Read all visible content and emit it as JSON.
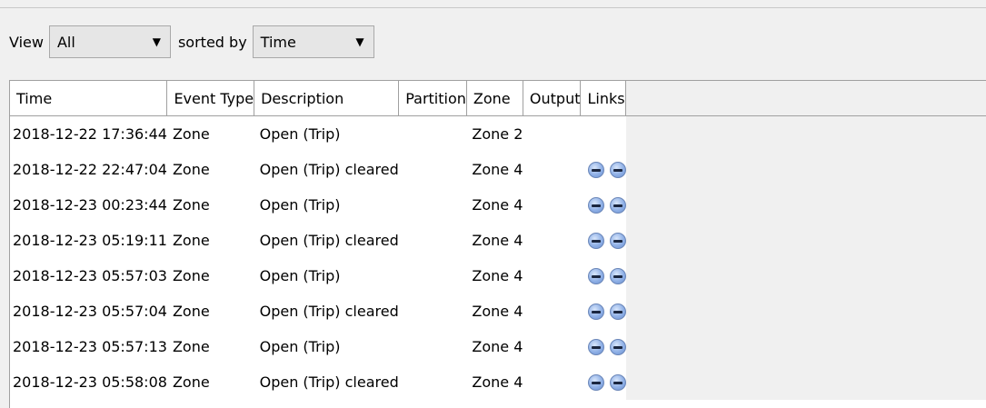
{
  "toolbar": {
    "view_label": "View",
    "view_value": "All",
    "sorted_label": "sorted by",
    "sort_value": "Time"
  },
  "table": {
    "columns": [
      "Time",
      "Event Type",
      "Description",
      "Partition",
      "Zone",
      "Output",
      "Links"
    ],
    "rows": [
      {
        "time": "2018-12-22 17:36:44",
        "event_type": "Zone",
        "description": "Open (Trip)",
        "partition": "",
        "zone": "Zone 2",
        "output": "",
        "links": 0
      },
      {
        "time": "2018-12-22 22:47:04",
        "event_type": "Zone",
        "description": "Open (Trip) cleared",
        "partition": "",
        "zone": "Zone 4",
        "output": "",
        "links": 2
      },
      {
        "time": "2018-12-23 00:23:44",
        "event_type": "Zone",
        "description": "Open (Trip)",
        "partition": "",
        "zone": "Zone 4",
        "output": "",
        "links": 2
      },
      {
        "time": "2018-12-23 05:19:11",
        "event_type": "Zone",
        "description": "Open (Trip) cleared",
        "partition": "",
        "zone": "Zone 4",
        "output": "",
        "links": 2
      },
      {
        "time": "2018-12-23 05:57:03",
        "event_type": "Zone",
        "description": "Open (Trip)",
        "partition": "",
        "zone": "Zone 4",
        "output": "",
        "links": 2
      },
      {
        "time": "2018-12-23 05:57:04",
        "event_type": "Zone",
        "description": "Open (Trip) cleared",
        "partition": "",
        "zone": "Zone 4",
        "output": "",
        "links": 2
      },
      {
        "time": "2018-12-23 05:57:13",
        "event_type": "Zone",
        "description": "Open (Trip)",
        "partition": "",
        "zone": "Zone 4",
        "output": "",
        "links": 2
      },
      {
        "time": "2018-12-23 05:58:08",
        "event_type": "Zone",
        "description": "Open (Trip) cleared",
        "partition": "",
        "zone": "Zone 4",
        "output": "",
        "links": 2
      }
    ],
    "link_icon": "camera-link-icon"
  }
}
